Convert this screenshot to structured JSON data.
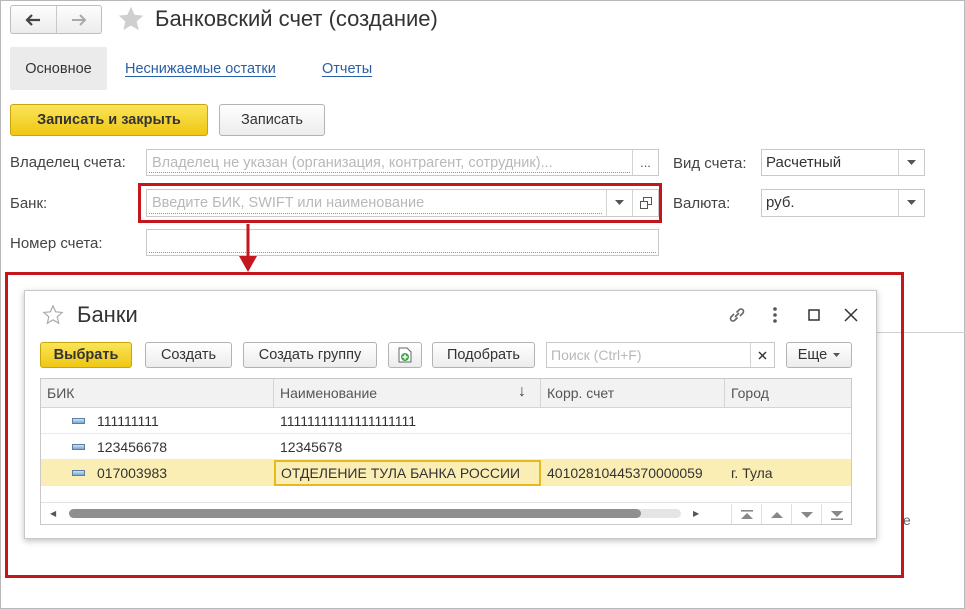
{
  "window": {
    "title": "Банковский счет (создание)"
  },
  "tabs": [
    {
      "label": "Основное",
      "active": true
    },
    {
      "label": "Неснижаемые остатки",
      "active": false
    },
    {
      "label": "Отчеты",
      "active": false
    }
  ],
  "toolbar": {
    "save_close_label": "Записать и закрыть",
    "save_label": "Записать"
  },
  "form": {
    "owner": {
      "label": "Владелец счета:",
      "placeholder": "Владелец не указан (организация, контрагент, сотрудник)...",
      "button": "..."
    },
    "bank": {
      "label": "Банк:",
      "placeholder": "Введите БИК, SWIFT или наименование"
    },
    "account_number": {
      "label": "Номер счета:",
      "value": ""
    },
    "account_type": {
      "label": "Вид счета:",
      "value": "Расчетный"
    },
    "currency": {
      "label": "Валюта:",
      "value": "руб."
    }
  },
  "stray_text": "е",
  "dialog": {
    "title": "Банки",
    "buttons": {
      "select": "Выбрать",
      "create": "Создать",
      "create_group": "Создать группу",
      "pick": "Подобрать",
      "more": "Еще"
    },
    "search_placeholder": "Поиск (Ctrl+F)",
    "columns": [
      "БИК",
      "Наименование",
      "Корр. счет",
      "Город"
    ],
    "sort_indicator": "↓",
    "rows": [
      {
        "bik": "111111111",
        "name": "11111111111111111111",
        "corr": "",
        "city": ""
      },
      {
        "bik": "123456678",
        "name": "12345678",
        "corr": "",
        "city": ""
      },
      {
        "bik": "017003983",
        "name": "ОТДЕЛЕНИЕ ТУЛА БАНКА РОССИИ",
        "corr": "40102810445370000059",
        "city": "г. Тула",
        "selected": true
      }
    ]
  },
  "colors": {
    "accent_yellow": "#f5d32c",
    "highlight_red": "#c4161c",
    "link_blue": "#2a5fa5",
    "selected_row": "#fbeeb5"
  }
}
